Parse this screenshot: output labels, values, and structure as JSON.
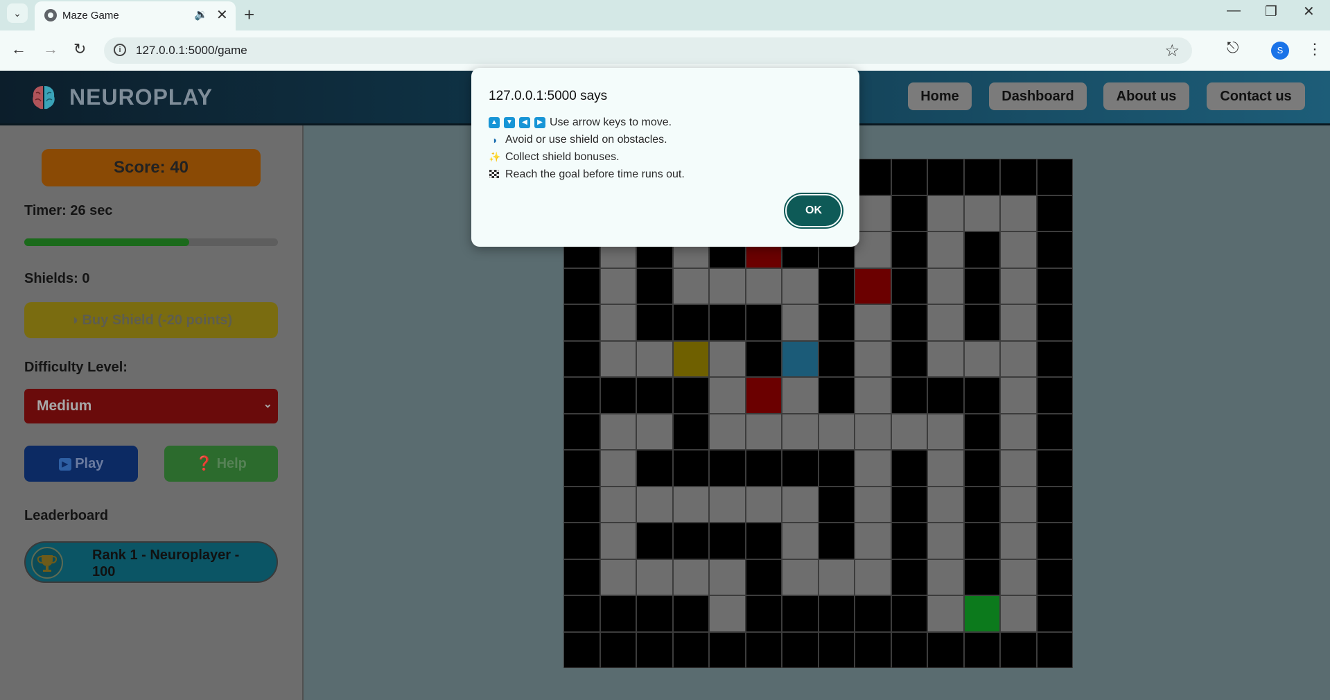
{
  "browser": {
    "tab_title": "Maze Game",
    "url": "127.0.0.1:5000/game",
    "profile_initial": "S"
  },
  "header": {
    "brand": "NEUROPLAY",
    "nav": [
      "Home",
      "Dashboard",
      "About us",
      "Contact us"
    ]
  },
  "sidebar": {
    "score_label": "Score: 40",
    "timer_label": "Timer: 26 sec",
    "timer_fraction": 0.65,
    "shields_label": "Shields: 0",
    "buy_shield_label": "Buy Shield (-20 points)",
    "difficulty_heading": "Difficulty Level:",
    "difficulty_value": "Medium",
    "play_label": "Play",
    "help_label": "Help",
    "leaderboard_heading": "Leaderboard",
    "leaderboard_entries": [
      "Rank 1 - Neuroplayer - 100"
    ]
  },
  "maze": {
    "legend": {
      "0": "wall",
      "1": "path",
      "2": "obstacle",
      "3": "shield-bonus",
      "4": "player",
      "5": "goal"
    },
    "colors": {
      "wall": "#000000",
      "path": "#6e6e6e",
      "obstacle": "#6b0000",
      "shield_bonus": "#6f6000",
      "player": "#1b5b78",
      "goal": "#0c7a1c"
    },
    "grid": [
      [
        0,
        0,
        0,
        0,
        0,
        0,
        0,
        0,
        0,
        0,
        0,
        0,
        0,
        0
      ],
      [
        0,
        1,
        1,
        1,
        1,
        1,
        1,
        1,
        1,
        0,
        1,
        1,
        1,
        0
      ],
      [
        0,
        1,
        0,
        1,
        0,
        2,
        0,
        0,
        1,
        0,
        1,
        0,
        1,
        0
      ],
      [
        0,
        1,
        0,
        1,
        1,
        1,
        1,
        0,
        2,
        0,
        1,
        0,
        1,
        0
      ],
      [
        0,
        1,
        0,
        0,
        0,
        0,
        1,
        0,
        1,
        0,
        1,
        0,
        1,
        0
      ],
      [
        0,
        1,
        1,
        3,
        1,
        0,
        4,
        0,
        1,
        0,
        1,
        1,
        1,
        0
      ],
      [
        0,
        0,
        0,
        0,
        1,
        2,
        1,
        0,
        1,
        0,
        0,
        0,
        1,
        0
      ],
      [
        0,
        1,
        1,
        0,
        1,
        1,
        1,
        1,
        1,
        1,
        1,
        0,
        1,
        0
      ],
      [
        0,
        1,
        0,
        0,
        0,
        0,
        0,
        0,
        1,
        0,
        1,
        0,
        1,
        0
      ],
      [
        0,
        1,
        1,
        1,
        1,
        1,
        1,
        0,
        1,
        0,
        1,
        0,
        1,
        0
      ],
      [
        0,
        1,
        0,
        0,
        0,
        0,
        1,
        0,
        1,
        0,
        1,
        0,
        1,
        0
      ],
      [
        0,
        1,
        1,
        1,
        1,
        0,
        1,
        1,
        1,
        0,
        1,
        0,
        1,
        0
      ],
      [
        0,
        0,
        0,
        0,
        1,
        0,
        0,
        0,
        0,
        0,
        1,
        5,
        1,
        0
      ],
      [
        0,
        0,
        0,
        0,
        0,
        0,
        0,
        0,
        0,
        0,
        0,
        0,
        0,
        0
      ]
    ]
  },
  "dialog": {
    "origin": "127.0.0.1:5000 says",
    "lines": [
      "Use arrow keys to move.",
      "Avoid or use shield on obstacles.",
      "Collect shield bonuses.",
      "Reach the goal before time runs out."
    ],
    "ok_label": "OK"
  }
}
